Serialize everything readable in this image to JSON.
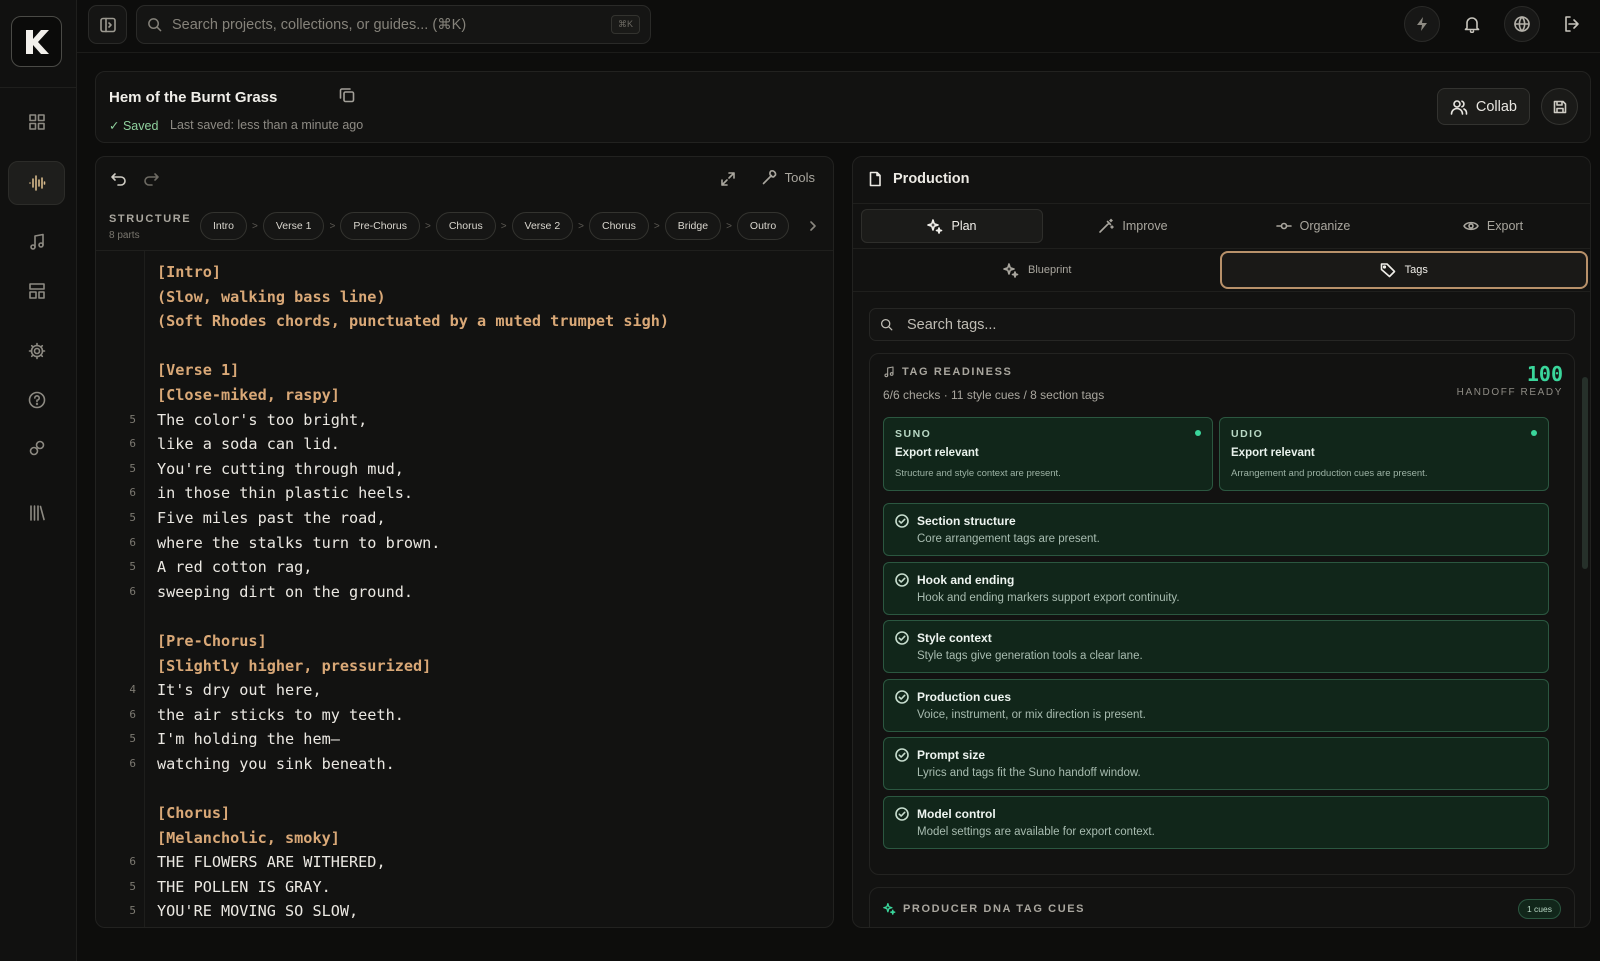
{
  "app": {
    "logo_text": "K"
  },
  "search": {
    "placeholder": "Search projects, collections, or guides... (⌘K)",
    "shortcut": "⌘K"
  },
  "document": {
    "title": "Hem of the Burnt Grass",
    "saved_label": "✓ Saved",
    "last_saved": "Last saved: less than a minute ago",
    "collab_label": "Collab"
  },
  "editor": {
    "tools_label": "Tools",
    "structure_label": "STRUCTURE",
    "parts_count": "8 parts",
    "sections": [
      "Intro",
      "Verse 1",
      "Pre-Chorus",
      "Chorus",
      "Verse 2",
      "Chorus",
      "Bridge",
      "Outro"
    ],
    "chip_separator": ">",
    "lines": [
      {
        "num": "",
        "text": "[Intro]",
        "kind": "tag"
      },
      {
        "num": "",
        "text": "(Slow, walking bass line)",
        "kind": "tag"
      },
      {
        "num": "",
        "text": "(Soft Rhodes chords, punctuated by a muted trumpet sigh)",
        "kind": "tag"
      },
      {
        "num": "",
        "text": "",
        "kind": "blank"
      },
      {
        "num": "",
        "text": "[Verse 1]",
        "kind": "tag"
      },
      {
        "num": "",
        "text": "[Close-miked, raspy]",
        "kind": "tag"
      },
      {
        "num": "5",
        "text": "The color's too bright,",
        "kind": "lyric"
      },
      {
        "num": "6",
        "text": "like a soda can lid.",
        "kind": "lyric"
      },
      {
        "num": "5",
        "text": "You're cutting through mud,",
        "kind": "lyric"
      },
      {
        "num": "6",
        "text": "in those thin plastic heels.",
        "kind": "lyric"
      },
      {
        "num": "5",
        "text": "Five miles past the road,",
        "kind": "lyric"
      },
      {
        "num": "6",
        "text": "where the stalks turn to brown.",
        "kind": "lyric"
      },
      {
        "num": "5",
        "text": "A red cotton rag,",
        "kind": "lyric"
      },
      {
        "num": "6",
        "text": "sweeping dirt on the ground.",
        "kind": "lyric"
      },
      {
        "num": "",
        "text": "",
        "kind": "blank"
      },
      {
        "num": "",
        "text": "[Pre-Chorus]",
        "kind": "tag"
      },
      {
        "num": "",
        "text": "[Slightly higher, pressurized]",
        "kind": "tag"
      },
      {
        "num": "4",
        "text": "It's dry out here,",
        "kind": "lyric"
      },
      {
        "num": "6",
        "text": "the air sticks to my teeth.",
        "kind": "lyric"
      },
      {
        "num": "5",
        "text": "I'm holding the hem—",
        "kind": "lyric"
      },
      {
        "num": "6",
        "text": "watching you sink beneath.",
        "kind": "lyric"
      },
      {
        "num": "",
        "text": "",
        "kind": "blank"
      },
      {
        "num": "",
        "text": "[Chorus]",
        "kind": "tag"
      },
      {
        "num": "",
        "text": "[Melancholic, smoky]",
        "kind": "tag"
      },
      {
        "num": "6",
        "text": "THE FLOWERS ARE WITHERED,",
        "kind": "lyric"
      },
      {
        "num": "5",
        "text": "THE POLLEN IS GRAY.",
        "kind": "lyric"
      },
      {
        "num": "5",
        "text": "YOU'RE MOVING SO SLOW,",
        "kind": "lyric"
      }
    ]
  },
  "production": {
    "title": "Production",
    "tabs": [
      "Plan",
      "Improve",
      "Organize",
      "Export"
    ],
    "active_tab": "Plan",
    "subtabs": [
      "Blueprint",
      "Tags"
    ],
    "active_subtab": "Tags",
    "tag_search_placeholder": "Search tags...",
    "readiness": {
      "title": "TAG READINESS",
      "summary": "6/6 checks · 11 style cues / 8 section tags",
      "score": "100",
      "status": "HANDOFF READY",
      "platforms": [
        {
          "name": "SUNO",
          "status": "Export relevant",
          "desc": "Structure and style context are present."
        },
        {
          "name": "UDIO",
          "status": "Export relevant",
          "desc": "Arrangement and production cues are present."
        }
      ],
      "checks": [
        {
          "title": "Section structure",
          "desc": "Core arrangement tags are present."
        },
        {
          "title": "Hook and ending",
          "desc": "Hook and ending markers support export continuity."
        },
        {
          "title": "Style context",
          "desc": "Style tags give generation tools a clear lane."
        },
        {
          "title": "Production cues",
          "desc": "Voice, instrument, or mix direction is present."
        },
        {
          "title": "Prompt size",
          "desc": "Lyrics and tags fit the Suno handoff window."
        },
        {
          "title": "Model control",
          "desc": "Model settings are available for export context."
        }
      ]
    },
    "dna": {
      "title": "PRODUCER DNA TAG CUES",
      "badge": "1 cues"
    }
  },
  "colors": {
    "accent_green": "#3ad69b",
    "tag_amber": "#d9a877",
    "active_outline": "#b8916a",
    "panel_green": "#11261a"
  }
}
